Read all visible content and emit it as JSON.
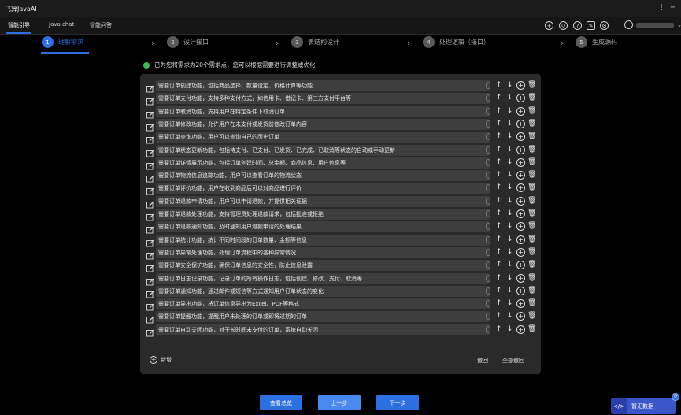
{
  "app": {
    "title": "飞算JavaAI"
  },
  "tabs": [
    {
      "label": "智能引导"
    },
    {
      "label": "Java chat"
    },
    {
      "label": "智能问答"
    }
  ],
  "toolbar_icons": [
    "add-icon",
    "history-icon",
    "help-icon",
    "edit-icon",
    "settings-icon"
  ],
  "steps": [
    {
      "num": "1",
      "label": "理解需求"
    },
    {
      "num": "2",
      "label": "设计接口"
    },
    {
      "num": "3",
      "label": "表结构设计"
    },
    {
      "num": "4",
      "label": "处理逻辑（接口）"
    },
    {
      "num": "5",
      "label": "生成源码"
    }
  ],
  "notice": "已为您将需求为20个需求点，您可以根据需要进行调整或优化",
  "requirements": [
    "需要订单创建功能，包括商品选择、数量设定、价格计算等功能",
    "需要订单支付功能，支持多种支付方式，如信用卡、借记卡、第三方支付平台等",
    "需要订单取消功能，支持用户在特定条件下取消订单",
    "需要订单修改功能，允许用户在未支付或发货前修改订单内容",
    "需要订单查询功能，用户可以查询自己的历史订单",
    "需要订单状态更新功能，包括待支付、已支付、已发货、已完成、已取消等状态的自动或手动更新",
    "需要订单详情展示功能，包括订单创建时间、总金额、商品信息、用户信息等",
    "需要订单物流信息追踪功能，用户可以查看订单的物流状态",
    "需要订单评价功能，用户在收到商品后可以对商品进行评价",
    "需要订单退款申请功能，用户可以申请退款，并提供相关证据",
    "需要订单退款处理功能，支持管理员处理退款请求，包括批准或拒绝",
    "需要订单退款通知功能，及时通知用户退款申请的处理结果",
    "需要订单统计功能，统计不同时间段的订单数量、金额等信息",
    "需要订单异常处理功能，处理订单流程中的各种异常情况",
    "需要订单安全保护功能，确保订单信息的安全性，防止信息泄露",
    "需要订单日志记录功能，记录订单的所有操作日志，包括创建、修改、支付、取消等",
    "需要订单通知功能，通过邮件或短信等方式通知用户订单状态的变化",
    "需要订单导出功能，将订单信息导出为Excel、PDF等格式",
    "需要订单提醒功能，提醒用户未处理的订单或即将过期的订单",
    "需要订单自动关闭功能，对于长时间未支付的订单，系统自动关闭"
  ],
  "actions": {
    "add": "新增",
    "undo": "撤回",
    "undo_all": "全部撤回"
  },
  "footer": {
    "view_summary": "查看总览",
    "prev": "上一步",
    "next": "下一步"
  },
  "float_widget": {
    "label": "暂无数据",
    "icon": "</>",
    "badge": "0"
  },
  "colors": {
    "accent": "#2c6fe0",
    "success": "#3fb950",
    "panel": "#2a2a2a"
  }
}
